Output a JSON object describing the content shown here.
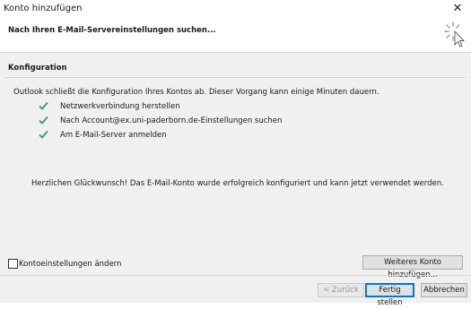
{
  "window": {
    "title": "Konto hinzufügen",
    "close_glyph": "✕"
  },
  "header": {
    "text": "Nach Ihren E-Mail-Servereinstellungen suchen...",
    "spinner_icon": "loading-spinner-icon"
  },
  "section": {
    "title": "Konfiguration",
    "intro": "Outlook schließt die Konfiguration Ihres Kontos ab. Dieser Vorgang kann einige Minuten dauern.",
    "steps": [
      {
        "label": "Netzwerkverbindung herstellen",
        "icon": "checkmark-icon",
        "status": "done"
      },
      {
        "label": "Nach Account@ex.uni-paderborn.de-Einstellungen suchen",
        "icon": "checkmark-icon",
        "status": "done"
      },
      {
        "label": "Am E-Mail-Server anmelden",
        "icon": "checkmark-icon",
        "status": "done"
      }
    ],
    "congrats": "Herzlichen Glückwunsch! Das E-Mail-Konto wurde erfolgreich konfiguriert und kann jetzt verwendet werden."
  },
  "options": {
    "change_settings_label": "Kontoeinstellungen ändern",
    "change_settings_checked": false
  },
  "buttons": {
    "add_another": "Weiteres Konto hinzufügen...",
    "back": "< Zurück",
    "finish": "Fertig stellen",
    "cancel": "Abbrechen"
  },
  "colors": {
    "check": "#3c9a5f",
    "accent": "#0078d7",
    "panel": "#f0f0f0"
  }
}
